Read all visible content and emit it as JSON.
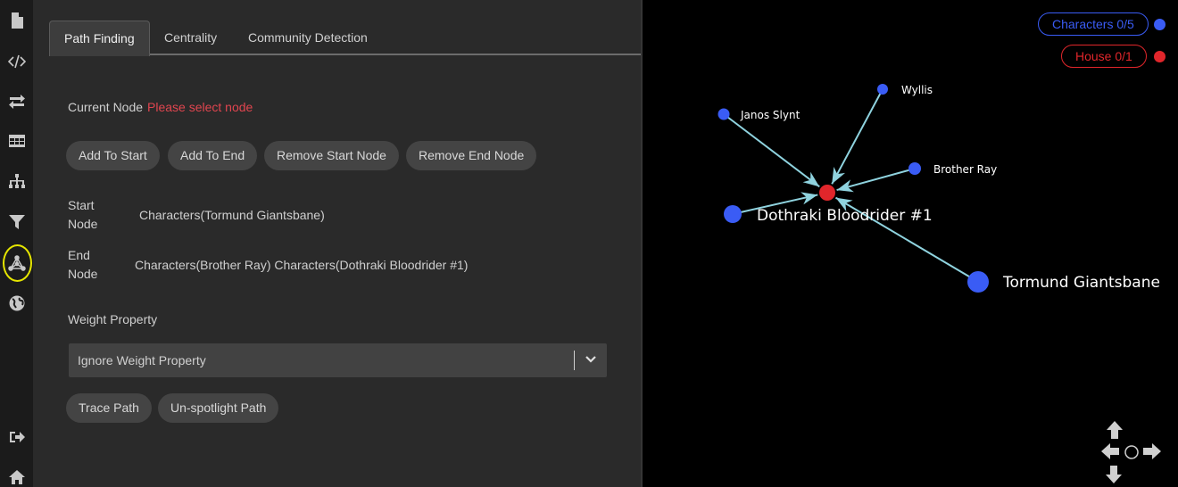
{
  "sidebar": {
    "items": [
      {
        "name": "file-icon"
      },
      {
        "name": "code-icon"
      },
      {
        "name": "swap-arrows-icon"
      },
      {
        "name": "table-icon"
      },
      {
        "name": "hierarchy-icon"
      },
      {
        "name": "filter-icon"
      },
      {
        "name": "graph-algorithm-icon",
        "active": true
      },
      {
        "name": "globe-icon"
      },
      {
        "name": "sign-out-icon"
      },
      {
        "name": "home-icon"
      }
    ]
  },
  "tabs": [
    {
      "label": "Path Finding",
      "active": true
    },
    {
      "label": "Centrality",
      "active": false
    },
    {
      "label": "Community Detection",
      "active": false
    }
  ],
  "path_finding": {
    "current_node_label": "Current Node",
    "current_node_value": "Please select node",
    "buttons": {
      "add_to_start": "Add To Start",
      "add_to_end": "Add To End",
      "remove_start": "Remove Start Node",
      "remove_end": "Remove End Node"
    },
    "start_node_label_1": "Start",
    "start_node_label_2": "Node",
    "start_node_value": "Characters(Tormund Giantsbane)",
    "end_node_label_1": "End",
    "end_node_label_2": "Node",
    "end_node_value": "Characters(Brother Ray) Characters(Dothraki Bloodrider #1)",
    "weight_label": "Weight Property",
    "weight_select_value": "Ignore Weight Property",
    "trace_path": "Trace Path",
    "unspotlight_path": "Un-spotlight Path"
  },
  "graph": {
    "legend": [
      {
        "label": "Characters 0/5",
        "color": "#3a5cf5"
      },
      {
        "label": "House 0/1",
        "color": "#e1262b"
      }
    ],
    "edge_color": "#8fd3df",
    "nodes": [
      {
        "id": "dothraki",
        "label": "Dothraki Bloodrider #1",
        "type": "Characters"
      },
      {
        "id": "janos",
        "label": "Janos Slynt",
        "type": "Characters"
      },
      {
        "id": "wyllis",
        "label": "Wyllis",
        "type": "Characters"
      },
      {
        "id": "brother",
        "label": "Brother Ray",
        "type": "Characters"
      },
      {
        "id": "tormund",
        "label": "Tormund Giantsbane",
        "type": "Characters"
      },
      {
        "id": "house",
        "label": "",
        "type": "House"
      }
    ],
    "edges": [
      {
        "from": "janos",
        "to": "house"
      },
      {
        "from": "wyllis",
        "to": "house"
      },
      {
        "from": "brother",
        "to": "house"
      },
      {
        "from": "dothraki",
        "to": "house"
      },
      {
        "from": "tormund",
        "to": "house"
      }
    ]
  }
}
